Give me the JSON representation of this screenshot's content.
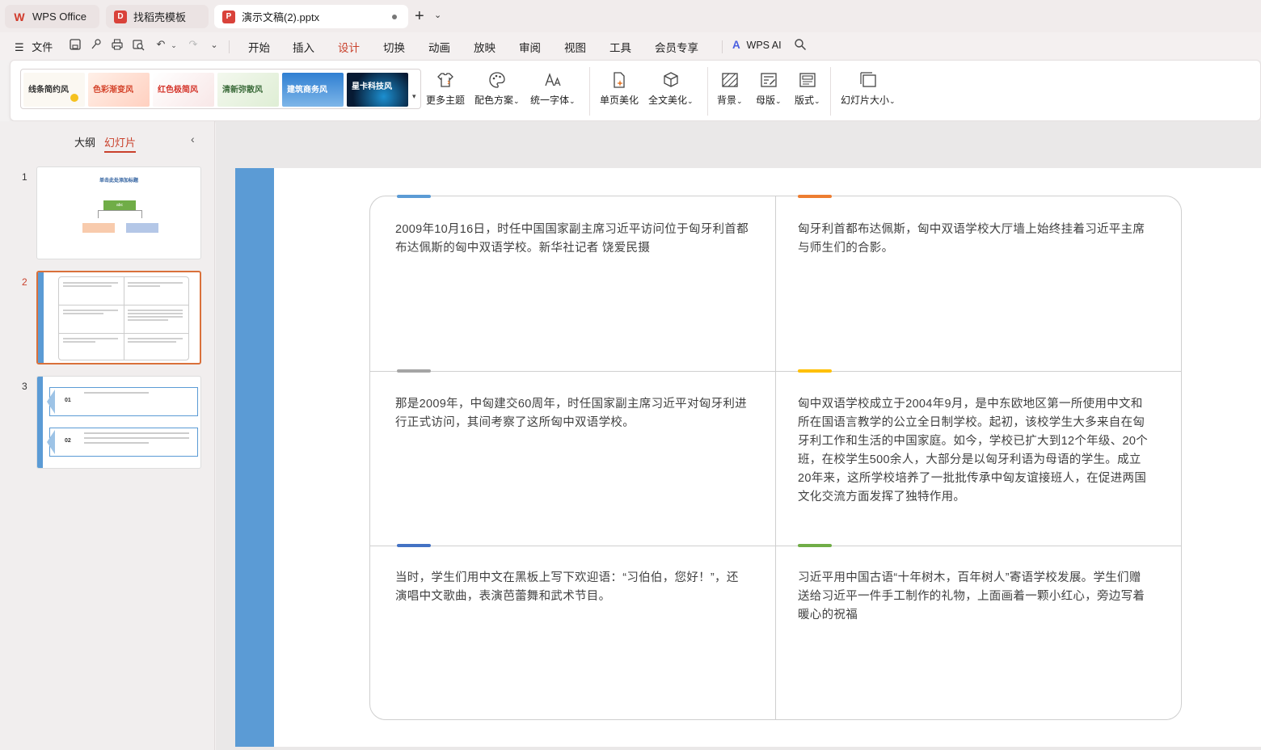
{
  "tabs": {
    "wps": "WPS Office",
    "template": "找稻壳模板",
    "document": "演示文稿(2).pptx"
  },
  "menu": {
    "file": "文件",
    "tabs": [
      "开始",
      "插入",
      "设计",
      "切换",
      "动画",
      "放映",
      "审阅",
      "视图",
      "工具",
      "会员专享"
    ],
    "active_tab": "设计",
    "ai": "WPS AI"
  },
  "ribbon": {
    "themes": [
      "线条简约风",
      "色彩渐变风",
      "红色极简风",
      "清新弥散风",
      "建筑商务风",
      "星卡科技风"
    ],
    "more_themes": "更多主题",
    "color_scheme": "配色方案",
    "unify_font": "统一字体",
    "single_beautify": "单页美化",
    "full_beautify": "全文美化",
    "background": "背景",
    "master": "母版",
    "layout": "版式",
    "slide_size": "幻灯片大小"
  },
  "panel": {
    "outline": "大纲",
    "slides": "幻灯片",
    "slide_numbers": [
      "1",
      "2",
      "3"
    ],
    "slide1_title": "单击此处添加标题",
    "slide1_box": "abc",
    "slide3_items": [
      "01",
      "02"
    ]
  },
  "slide": {
    "accent_colors": [
      "#5b9bd5",
      "#ed7d31",
      "#a5a5a5",
      "#ffc000",
      "#4472c4",
      "#70ad47"
    ],
    "cells": [
      "2009年10月16日，时任中国国家副主席习近平访问位于匈牙利首都布达佩斯的匈中双语学校。新华社记者 饶爱民摄",
      "匈牙利首都布达佩斯，匈中双语学校大厅墙上始终挂着习近平主席与师生们的合影。",
      "那是2009年，中匈建交60周年，时任国家副主席习近平对匈牙利进行正式访问，其间考察了这所匈中双语学校。",
      "匈中双语学校成立于2004年9月，是中东欧地区第一所使用中文和所在国语言教学的公立全日制学校。起初，该校学生大多来自在匈牙利工作和生活的中国家庭。如今，学校已扩大到12个年级、20个班，在校学生500余人，大部分是以匈牙利语为母语的学生。成立20年来，这所学校培养了一批批传承中匈友谊接班人，在促进两国文化交流方面发挥了独特作用。",
      "当时，学生们用中文在黑板上写下欢迎语：“习伯伯，您好！”，还演唱中文歌曲，表演芭蕾舞和武术节目。",
      "习近平用中国古语“十年树木，百年树人”寄语学校发展。学生们赠送给习近平一件手工制作的礼物，上面画着一颗小红心，旁边写着暖心的祝福"
    ]
  }
}
